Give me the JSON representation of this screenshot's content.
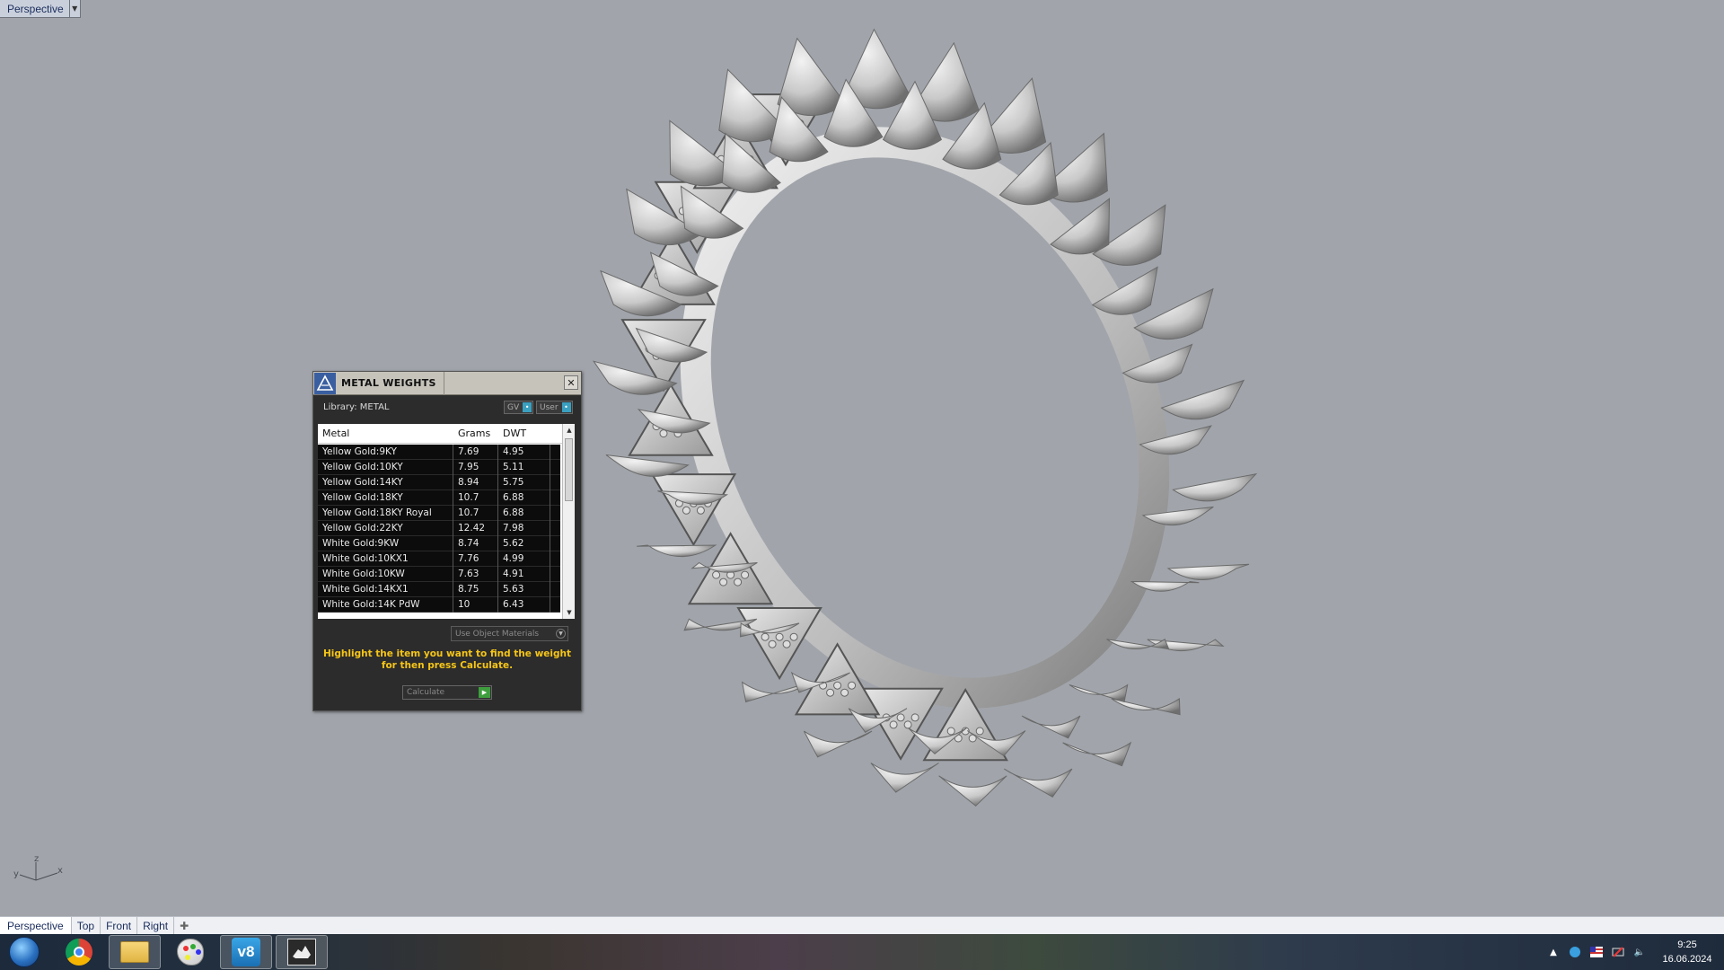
{
  "viewport": {
    "title": "Perspective"
  },
  "metal_weights": {
    "title": "METAL WEIGHTS",
    "library_label": "Library: METAL",
    "toggle_gv": "GV",
    "toggle_user": "User",
    "columns": [
      "Metal",
      "Grams",
      "DWT"
    ],
    "rows": [
      {
        "metal": "Yellow Gold:9KY",
        "grams": "7.69",
        "dwt": "4.95"
      },
      {
        "metal": "Yellow Gold:10KY",
        "grams": "7.95",
        "dwt": "5.11"
      },
      {
        "metal": "Yellow Gold:14KY",
        "grams": "8.94",
        "dwt": "5.75"
      },
      {
        "metal": "Yellow Gold:18KY",
        "grams": "10.7",
        "dwt": "6.88"
      },
      {
        "metal": "Yellow Gold:18KY Royal",
        "grams": "10.7",
        "dwt": "6.88"
      },
      {
        "metal": "Yellow Gold:22KY",
        "grams": "12.42",
        "dwt": "7.98"
      },
      {
        "metal": "White Gold:9KW",
        "grams": "8.74",
        "dwt": "5.62"
      },
      {
        "metal": "White Gold:10KX1",
        "grams": "7.76",
        "dwt": "4.99"
      },
      {
        "metal": "White Gold:10KW",
        "grams": "7.63",
        "dwt": "4.91"
      },
      {
        "metal": "White Gold:14KX1",
        "grams": "8.75",
        "dwt": "5.63"
      },
      {
        "metal": "White Gold:14K PdW",
        "grams": "10",
        "dwt": "6.43"
      }
    ],
    "material_select": "Use Object Materials",
    "hint": "Highlight the item you want to find the weight for then press Calculate.",
    "calculate_label": "Calculate"
  },
  "axis": {
    "x": "x",
    "y": "y",
    "z": "z"
  },
  "tabs": [
    "Perspective",
    "Top",
    "Front",
    "Right"
  ],
  "tab_add_icon": "plus-icon",
  "taskbar": {
    "apps": [
      "chrome-icon",
      "folder-icon",
      "paint-icon",
      "v8-icon",
      "rhino-icon"
    ],
    "v8_text": "v8",
    "clock_time": "9:25",
    "clock_date": "16.06.2024"
  }
}
